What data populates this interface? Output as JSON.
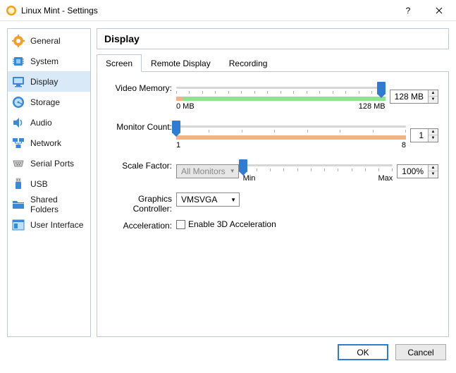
{
  "window": {
    "title": "Linux Mint - Settings"
  },
  "sidebar": {
    "items": [
      {
        "label": "General"
      },
      {
        "label": "System"
      },
      {
        "label": "Display"
      },
      {
        "label": "Storage"
      },
      {
        "label": "Audio"
      },
      {
        "label": "Network"
      },
      {
        "label": "Serial Ports"
      },
      {
        "label": "USB"
      },
      {
        "label": "Shared Folders"
      },
      {
        "label": "User Interface"
      }
    ],
    "selected_index": 2
  },
  "page": {
    "title": "Display",
    "tabs": [
      {
        "label": "Screen"
      },
      {
        "label": "Remote Display"
      },
      {
        "label": "Recording"
      }
    ],
    "active_tab": 0
  },
  "screen": {
    "video_memory": {
      "label": "Video Memory:",
      "value": "128 MB",
      "min_label": "0 MB",
      "max_label": "128 MB",
      "position_pct": 98,
      "green_start_pct": 3,
      "green_end_pct": 100,
      "orange_start_pct": 0,
      "orange_end_pct": 3
    },
    "monitor_count": {
      "label": "Monitor Count:",
      "value": "1",
      "min_label": "1",
      "max_label": "8",
      "position_pct": 0,
      "orange_start_pct": 0,
      "orange_end_pct": 100
    },
    "scale_factor": {
      "label": "Scale Factor:",
      "combo_value": "All Monitors",
      "value": "100%",
      "min_label": "Min",
      "max_label": "Max",
      "position_pct": 0
    },
    "graphics_controller": {
      "label": "Graphics Controller:",
      "value": "VMSVGA"
    },
    "acceleration": {
      "label": "Acceleration:",
      "checkbox_label": "Enable 3D Acceleration",
      "checked": false
    }
  },
  "dialog": {
    "ok": "OK",
    "cancel": "Cancel"
  },
  "icons": {
    "general_color": "#f0a030",
    "system_color": "#3a88d6",
    "display_color": "#3a88d6",
    "storage_color": "#3a88d6",
    "audio_color": "#3a88d6",
    "network_color": "#3a88d6",
    "serial_color": "#9a9a9a",
    "usb_color": "#3a88d6",
    "folder_color": "#3a88d6",
    "ui_color": "#3a88d6"
  }
}
